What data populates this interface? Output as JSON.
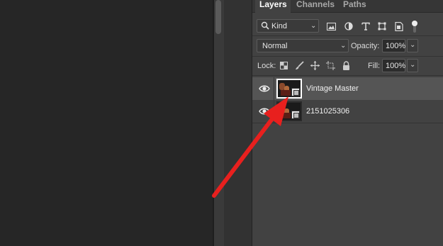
{
  "panel": {
    "tabs": [
      {
        "label": "Layers",
        "active": true
      },
      {
        "label": "Channels",
        "active": false
      },
      {
        "label": "Paths",
        "active": false
      }
    ],
    "filter": {
      "kind_label": "Kind",
      "icons": [
        "image-filter-icon",
        "adjustment-filter-icon",
        "type-filter-icon",
        "shape-filter-icon",
        "smart-object-filter-icon",
        "filter-toggle-icon"
      ]
    },
    "blend_mode": "Normal",
    "opacity_label": "Opacity:",
    "opacity_value": "100%",
    "lock_label": "Lock:",
    "lock_icons": [
      "lock-transparent-pixels-icon",
      "lock-image-pixels-icon",
      "lock-position-icon",
      "lock-artboard-icon",
      "lock-all-icon"
    ],
    "fill_label": "Fill:",
    "fill_value": "100%",
    "layers": [
      {
        "name": "Vintage Master",
        "visible": true,
        "selected": true,
        "smart_object": true
      },
      {
        "name": "2151025306",
        "visible": true,
        "selected": false,
        "smart_object": true
      }
    ]
  },
  "annotation": {
    "arrow_color": "#e8201e"
  },
  "colors": {
    "panel_bg": "#424242",
    "workspace_bg": "#262626",
    "selected_row": "#555555"
  }
}
